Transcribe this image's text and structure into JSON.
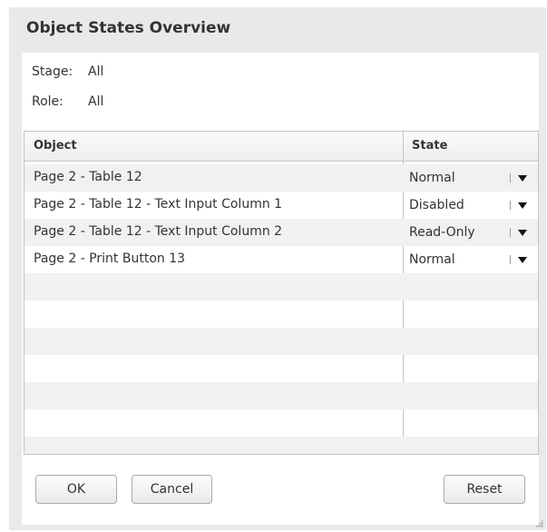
{
  "dialog": {
    "title": "Object States Overview"
  },
  "info": {
    "stage_label": "Stage:",
    "stage_value": "All",
    "role_label": "Role:",
    "role_value": "All"
  },
  "table": {
    "columns": [
      "Object",
      "State"
    ],
    "rows": [
      {
        "object": "Page 2 - Table 12",
        "state": "Normal"
      },
      {
        "object": "Page 2 - Table 12 - Text Input Column 1",
        "state": "Disabled"
      },
      {
        "object": "Page 2 - Table 12 - Text Input Column 2",
        "state": "Read-Only"
      },
      {
        "object": "Page 2 - Print Button 13",
        "state": "Normal"
      }
    ]
  },
  "buttons": {
    "ok": "OK",
    "cancel": "Cancel",
    "reset": "Reset"
  },
  "icons": {
    "dropdown": "chevron-down-icon",
    "resize": "resize-grip-icon"
  }
}
